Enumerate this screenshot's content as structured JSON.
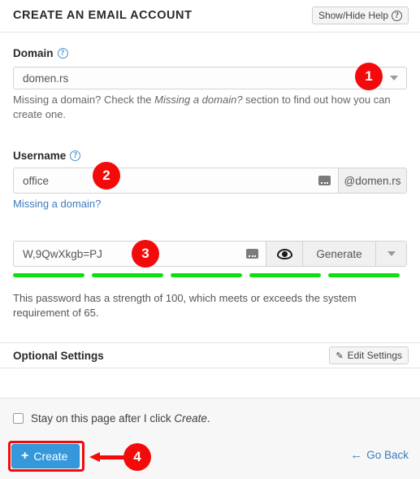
{
  "header": {
    "title": "CREATE AN EMAIL ACCOUNT",
    "help_button": "Show/Hide Help",
    "help_icon": "question-circle-icon"
  },
  "domain": {
    "label": "Domain",
    "help_icon": "question-circle-icon",
    "value": "domen.rs",
    "dropdown_icon": "chevron-down-icon",
    "helper_prefix": "Missing a domain? Check the ",
    "helper_italic": "Missing a domain?",
    "helper_suffix": " section to find out how you can create one."
  },
  "username": {
    "label": "Username",
    "help_icon": "question-circle-icon",
    "value": "office",
    "autofill_icon": "keyboard-icon",
    "addon": "@domen.rs",
    "link": "Missing a domain?"
  },
  "password": {
    "value": "W,9QwXkgb=PJ",
    "autofill_icon": "keyboard-icon",
    "toggle_icon": "eye-icon",
    "generate_label": "Generate",
    "dropdown_icon": "chevron-down-icon",
    "strength_bars": 5,
    "strength_color": "#0ee00e",
    "strength_text": "This password has a strength of 100, which meets or exceeds the system requirement of 65.",
    "strength_value": 100,
    "strength_requirement": 65
  },
  "optional": {
    "title": "Optional Settings",
    "edit_button": "Edit Settings",
    "edit_icon": "pencil-icon"
  },
  "footer": {
    "checkbox_prefix": "Stay on this page after I click ",
    "checkbox_em": "Create",
    "checkbox_suffix": ".",
    "checkbox_checked": false,
    "create_label": "Create",
    "create_plus": "+",
    "goback_label": "Go Back",
    "goback_icon": "arrow-left-icon"
  },
  "annotations": {
    "badges": [
      {
        "num": "1"
      },
      {
        "num": "2"
      },
      {
        "num": "3"
      },
      {
        "num": "4"
      }
    ],
    "accent_color": "#f40a0a"
  }
}
